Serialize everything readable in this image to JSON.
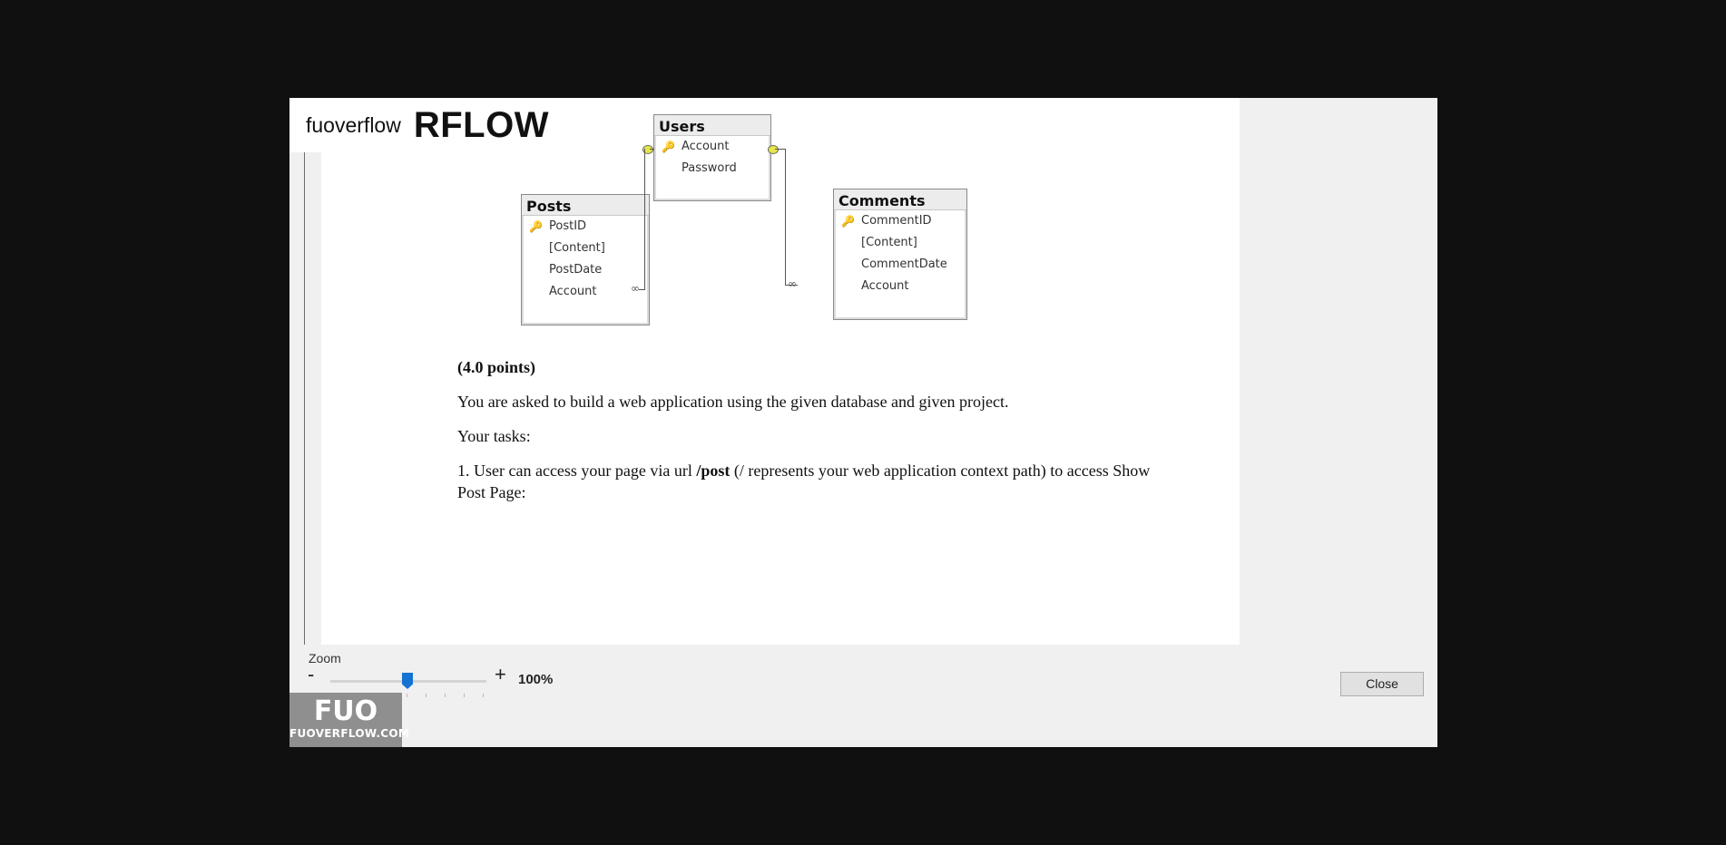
{
  "logo": {
    "small": "fuoverflow",
    "big": "RFLOW"
  },
  "diagram": {
    "users": {
      "title": "Users",
      "fields": [
        {
          "name": "Account",
          "key": true
        },
        {
          "name": "Password",
          "key": false
        }
      ]
    },
    "posts": {
      "title": "Posts",
      "fields": [
        {
          "name": "PostID",
          "key": true
        },
        {
          "name": "[Content]",
          "key": false
        },
        {
          "name": "PostDate",
          "key": false
        },
        {
          "name": "Account",
          "key": false
        }
      ]
    },
    "comments": {
      "title": "Comments",
      "fields": [
        {
          "name": "CommentID",
          "key": true
        },
        {
          "name": "[Content]",
          "key": false
        },
        {
          "name": "CommentDate",
          "key": false
        },
        {
          "name": "Account",
          "key": false
        }
      ]
    }
  },
  "document": {
    "points": "(4.0 points)",
    "intro": "You are asked to build a web application using the given database and given project.",
    "tasks_label": "Your tasks:",
    "task1_prefix": "1. User can access your page via url ",
    "task1_url": "/post",
    "task1_suffix": " (/ represents your web application context path) to access Show",
    "task1_line2": "Post Page:"
  },
  "zoom": {
    "label": "Zoom",
    "minus": "-",
    "plus": "+",
    "value": "100%",
    "level_fraction": 0.5
  },
  "close_label": "Close",
  "badge": {
    "mark": "FUO",
    "url": "FUOVERFLOW.COM"
  },
  "icons": {
    "key": "key-icon",
    "scroll_down": "chevron-down-icon"
  }
}
